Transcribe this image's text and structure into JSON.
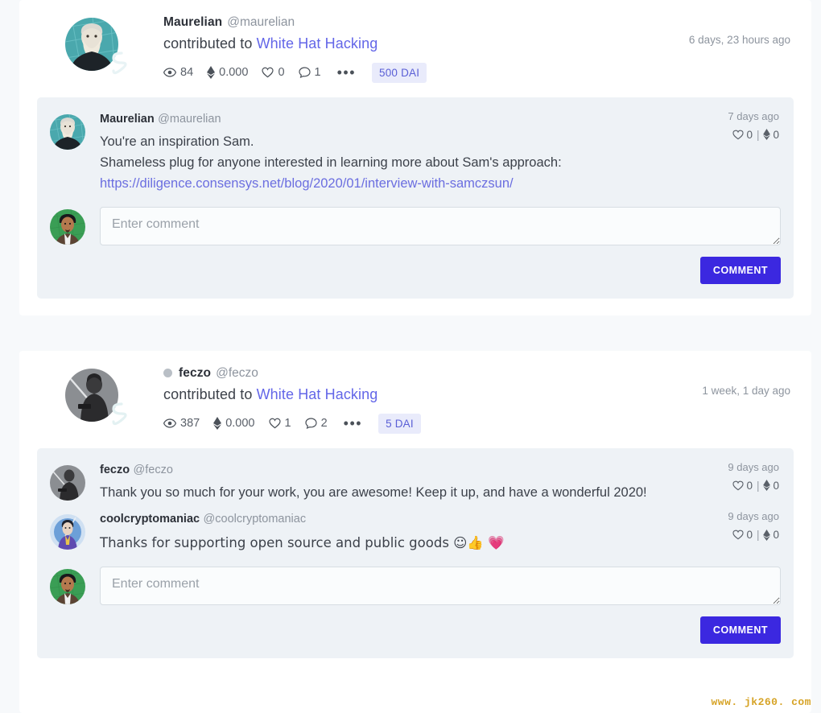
{
  "watermark": "www. jk260. com",
  "theme": {
    "page_bg": "#f7f9fb",
    "card_bg": "#ffffff",
    "comments_bg": "#eef2f6",
    "link_color": "#6366e8",
    "badge_bg": "#e9ebfb",
    "badge_text": "#5a5fd6",
    "button_bg": "#3b28e0",
    "watermark_color": "#d6a326"
  },
  "editor": {
    "placeholder": "Enter comment",
    "value": "",
    "button_label": "COMMENT"
  },
  "posts": [
    {
      "id": "post-maurelian",
      "author_name": "Maurelian",
      "author_handle": "@maurelian",
      "has_status_dot": false,
      "action_text": "contributed to",
      "project_link": "White Hat Hacking",
      "timestamp": "6 days, 23 hours ago",
      "stats": {
        "views_icon": "eye-icon",
        "views": "84",
        "eth_icon": "ethereum-icon",
        "eth": "0.000",
        "likes_icon": "heart-icon",
        "likes": "0",
        "comments_icon": "comment-icon",
        "comments": "1",
        "more_icon": "ellipsis-icon"
      },
      "amount_badge": "500 DAI",
      "comments": [
        {
          "author_name": "Maurelian",
          "author_handle": "@maurelian",
          "timestamp": "7 days ago",
          "likes": "0",
          "tips": "0",
          "lines": [
            {
              "type": "text",
              "value": "You're an inspiration Sam."
            },
            {
              "type": "text",
              "value": "Shameless plug for anyone interested in learning more about Sam's approach:"
            },
            {
              "type": "link",
              "value": "https://diligence.consensys.net/blog/2020/01/interview-with-samczsun/"
            }
          ]
        }
      ]
    },
    {
      "id": "post-feczo",
      "author_name": "feczo",
      "author_handle": "@feczo",
      "has_status_dot": true,
      "action_text": "contributed to",
      "project_link": "White Hat Hacking",
      "timestamp": "1 week, 1 day ago",
      "stats": {
        "views_icon": "eye-icon",
        "views": "387",
        "eth_icon": "ethereum-icon",
        "eth": "0.000",
        "likes_icon": "heart-icon",
        "likes": "1",
        "comments_icon": "comment-icon",
        "comments": "2",
        "more_icon": "ellipsis-icon"
      },
      "amount_badge": "5 DAI",
      "comments": [
        {
          "author_name": "feczo",
          "author_handle": "@feczo",
          "timestamp": "9 days ago",
          "likes": "0",
          "tips": "0",
          "lines": [
            {
              "type": "text",
              "value": "Thank you so much for your work, you are awesome! Keep it up, and have a wonderful 2020!"
            }
          ]
        },
        {
          "author_name": "coolcryptomaniac",
          "author_handle": "@coolcryptomaniac",
          "timestamp": "9 days ago",
          "likes": "0",
          "tips": "0",
          "lines": [
            {
              "type": "text",
              "value": "Thanks for supporting open source and public goods ☺👍 💗"
            }
          ]
        }
      ]
    }
  ]
}
